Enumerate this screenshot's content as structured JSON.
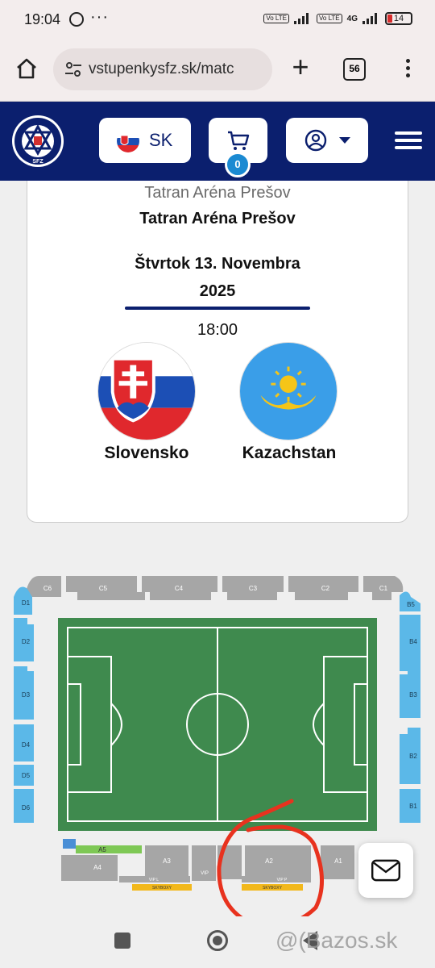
{
  "status_bar": {
    "time": "19:04",
    "more": "···",
    "lte1": "Vo LTE",
    "lte2": "Vo LTE",
    "net": "4G",
    "battery": "14"
  },
  "browser": {
    "url": "vstupenkysfz.sk/matc",
    "tab_count": "56"
  },
  "header": {
    "lang_code": "SK",
    "cart_count": "0",
    "logo_text": "SFZ"
  },
  "event": {
    "venue_subtitle": "Tatran Aréna Prešov",
    "venue_title": "Tatran Aréna Prešov",
    "date_line1": "Štvrtok 13. Novembra",
    "date_line2": "2025",
    "time": "18:00",
    "home_team": "Slovensko",
    "away_team": "Kazachstan"
  },
  "stadium": {
    "top_sections": [
      "C6",
      "C5",
      "C4",
      "C3",
      "C2",
      "C1"
    ],
    "left_sections": [
      "D1",
      "D2",
      "D3",
      "D4",
      "D5",
      "D6"
    ],
    "right_sections": [
      "B5",
      "B4",
      "B3",
      "B2",
      "B1"
    ],
    "bottom_sections": [
      "A5",
      "A4",
      "A3",
      "VIP L",
      "VIP",
      "A2",
      "VIP P",
      "A1"
    ],
    "skybox_label": "SKYBOXY"
  },
  "watermark": "@(Bazos.sk"
}
